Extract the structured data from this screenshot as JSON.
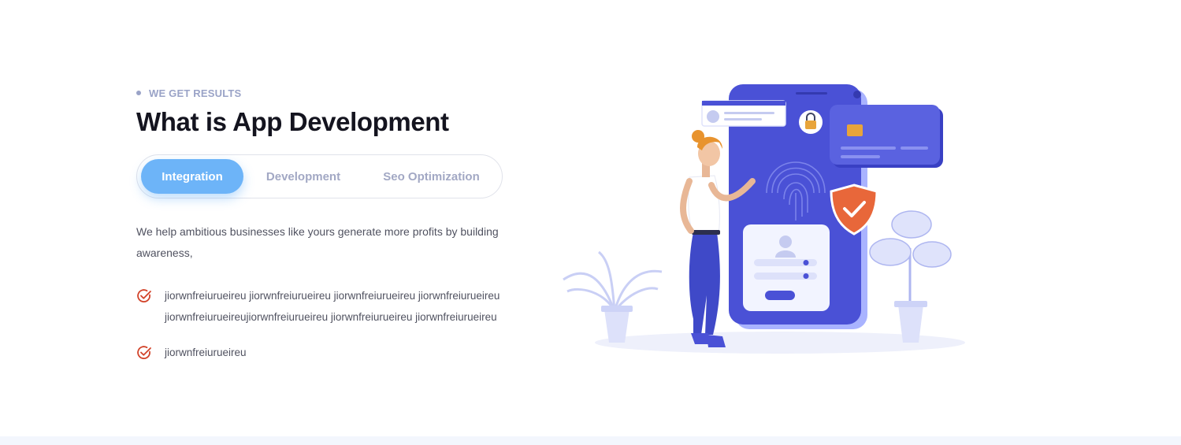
{
  "eyebrow": {
    "label": "WE GET RESULTS"
  },
  "heading": "What is App Development",
  "tabs": [
    {
      "label": "Integration",
      "active": true
    },
    {
      "label": "Development",
      "active": false
    },
    {
      "label": "Seo Optimization",
      "active": false
    }
  ],
  "description": "We help ambitious businesses like yours generate more profits by building awareness,",
  "bullets": [
    {
      "text": "jiorwnfreiurueireu jiorwnfreiurueireu jiorwnfreiurueireu jiorwnfreiurueireu jiorwnfreiurueireujiorwnfreiurueireu jiorwnfreiurueireu jiorwnfreiurueireu"
    },
    {
      "text": "jiorwnfreiurueireu"
    }
  ],
  "illustration": {
    "icons": [
      "check-circle-icon",
      "lock-icon",
      "fingerprint-icon",
      "shield-check-icon",
      "user-icon",
      "credit-card-icon"
    ]
  },
  "colors": {
    "accent_blue": "#6db4f8",
    "phone_indigo": "#4a51d6",
    "check_red": "#d2432a",
    "shield_orange": "#e8673a",
    "heading": "#14141f",
    "muted": "#9aa3c7"
  }
}
